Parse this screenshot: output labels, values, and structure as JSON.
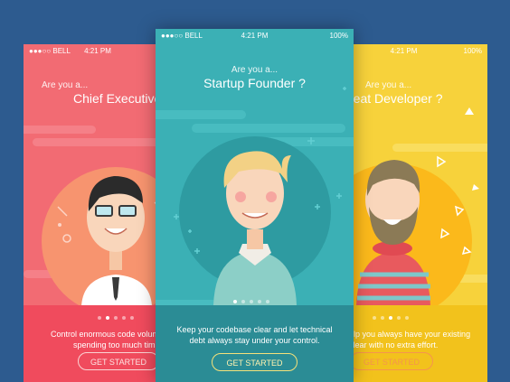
{
  "screens": [
    {
      "id": "left",
      "status": {
        "carrier": "●●●○○ BELL",
        "time": "4:21 PM"
      },
      "question": "Are you a...",
      "role": "Chief Executive",
      "description_lines": [
        "Control enormous code volum",
        "spending too much tim"
      ],
      "button_label": "GET STARTED",
      "colors": {
        "background": "#f26b73",
        "bottom": "#f04b5d",
        "circle": "#f7946f",
        "button_text": "#fde2e2"
      }
    },
    {
      "id": "center",
      "status": {
        "carrier": "●●●○○ BELL",
        "time": "4:21 PM",
        "battery": "100%"
      },
      "question": "Are you a...",
      "role": "Startup Founder ?",
      "description_lines": [
        "Keep your codebase clear and let technical",
        "debt always stay under your control."
      ],
      "button_label": "GET STARTED",
      "colors": {
        "background": "#3bb0b5",
        "bottom": "#2b8c95",
        "circle": "#2e9ba1",
        "button_text": "#fff3b0"
      }
    },
    {
      "id": "right",
      "status": {
        "time": "4:21 PM",
        "battery": "100%"
      },
      "question": "Are you a...",
      "role": "reat Developer ?",
      "description_lines": [
        "elp you always have your existing",
        "clear with no extra effort."
      ],
      "button_label": "GET STARTED",
      "colors": {
        "background": "#f7d23b",
        "bottom": "#f2c21c",
        "circle": "#fbb91b",
        "button_text": "#f6944e"
      }
    }
  ],
  "pager": {
    "count": 5
  }
}
